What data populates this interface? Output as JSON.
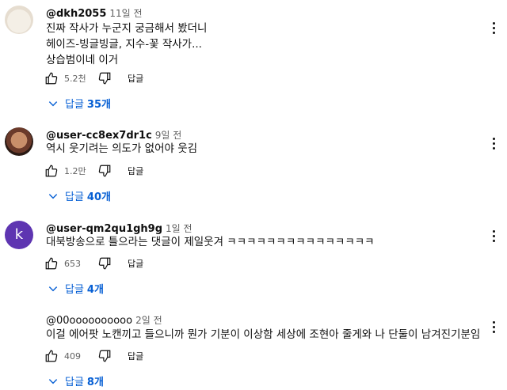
{
  "comments": [
    {
      "author": "@dkh2055",
      "time": "11일 전",
      "lines": [
        "진짜 작사가 누군지 궁금해서 봤더니",
        "헤이즈-빙글빙글, 지수-꽃 작사가...",
        "상습범이네 이거"
      ],
      "likes": "5.2천",
      "reply_label": "답글",
      "replies_label": "답글",
      "replies_count": "35개",
      "avatar": "cat-avatar"
    },
    {
      "author": "@user-cc8ex7dr1c",
      "time": "9일 전",
      "lines": [
        "역시 웃기려는 의도가 없어야 웃김"
      ],
      "likes": "1.2만",
      "reply_label": "답글",
      "replies_label": "답글",
      "replies_count": "40개",
      "avatar": "photo-avatar"
    },
    {
      "author": "@user-qm2qu1gh9g",
      "time": "1일 전",
      "lines": [
        "대북방송으로 틀으라는 댓글이 제일웃겨 ㅋㅋㅋㅋㅋㅋㅋㅋㅋㅋㅋㅋㅋㅋㅋ"
      ],
      "likes": "653",
      "reply_label": "답글",
      "replies_label": "답글",
      "replies_count": "4개",
      "avatar": "letter-avatar",
      "avatar_letter": "k",
      "avatar_color": "#5e35b1"
    },
    {
      "author": "@00oooooooooo",
      "time": "2일 전",
      "lines": [
        "이걸 에어팟 노캔끼고 들으니까 뭔가 기분이 이상함 세상에 조현아 줄게와 나 단둘이 남겨진기분임"
      ],
      "likes": "409",
      "reply_label": "답글",
      "replies_label": "답글",
      "replies_count": "8개",
      "avatar": "none"
    }
  ],
  "colors": {
    "link": "#065fd4",
    "meta": "#606060",
    "avatar_k": "#5e35b1"
  }
}
